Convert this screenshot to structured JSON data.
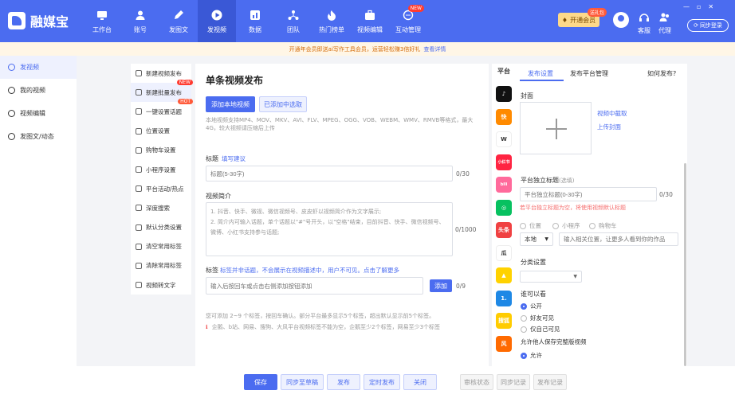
{
  "app": {
    "name": "融媒宝",
    "vip_label": "开通会员",
    "vip_tag": "送礼包"
  },
  "nav": [
    {
      "label": "工作台",
      "icon": "monitor-icon"
    },
    {
      "label": "账号",
      "icon": "user-icon"
    },
    {
      "label": "发图文",
      "icon": "pen-icon"
    },
    {
      "label": "发视频",
      "icon": "play-icon",
      "active": true
    },
    {
      "label": "数据",
      "icon": "chart-icon"
    },
    {
      "label": "团队",
      "icon": "team-icon"
    },
    {
      "label": "热门榜单",
      "icon": "fire-icon"
    },
    {
      "label": "视频编辑",
      "icon": "briefcase-icon"
    },
    {
      "label": "互动管理",
      "icon": "chat-icon",
      "badge": "NEW"
    }
  ],
  "tools": {
    "service": "客服",
    "agent": "代理",
    "sync": "同步登录"
  },
  "notice": {
    "text": "开通年会员即送ai写作工具会员，运营轻松赚3倍好礼",
    "link": "查看详情"
  },
  "sidebar": [
    {
      "label": "发视频",
      "active": true
    },
    {
      "label": "我的视频"
    },
    {
      "label": "视频编辑"
    },
    {
      "label": "发图文/动态"
    }
  ],
  "submenu": [
    {
      "label": "新建视频发布",
      "icon": "list-icon"
    },
    {
      "label": "新建批量发布",
      "icon": "batch-icon",
      "active": true,
      "badge": "NEW",
      "badge_color": "#ff3b30"
    },
    {
      "label": "一键设置话题",
      "icon": "hash-icon",
      "badge": "HOT",
      "badge_color": "#ff5a3a"
    },
    {
      "label": "位置设置",
      "icon": "location-icon"
    },
    {
      "label": "购物车设置",
      "icon": "cart-icon"
    },
    {
      "label": "小程序设置",
      "icon": "miniapp-icon"
    },
    {
      "label": "平台活动/热点",
      "icon": "flag-icon"
    },
    {
      "label": "深度搜索",
      "icon": "search-icon"
    },
    {
      "label": "默认分类设置",
      "icon": "category-icon"
    },
    {
      "label": "清空常用标签",
      "icon": "tag-icon"
    },
    {
      "label": "清除常用标签",
      "icon": "tag-icon"
    },
    {
      "label": "视频转文字",
      "icon": "transcribe-icon"
    }
  ],
  "form": {
    "title": "单条视频发布",
    "add_local": "添加本地视频",
    "add_existing": "已添加中选取",
    "format_hint": "本地视频支持MP4、MOV、MKV、AVI、FLV、MPEG、OGG、VOB、WEBM、WMV、RMVB等格式，最大4G，较大视频请压缩后上传",
    "title_label": "标题",
    "title_tip": "填写建议",
    "title_placeholder": "标题(5-30字)",
    "title_count": "0/30",
    "desc_label": "视频简介",
    "desc_line1": "1. 抖音、快手、微视、微信视频号、皮皮虾以视频简介作为文字展示;",
    "desc_line2": "2. 简介内可输入话题，单个话题以\"#\"号开头，以\"空格\"结束，目前抖音、快手、微信视频号、微博、小红书支持参与话题;",
    "desc_count": "0/1000",
    "tag_label": "标签",
    "tag_tip": "标签并非话题，不会展示在视频描述中，用户不可见。点击了解更多",
    "tag_placeholder": "输入后按回车或点击右侧添加按钮添加",
    "tag_add": "添加",
    "tag_count": "0/9",
    "tag_hint": "您可添加 2~9 个标签，按回车确认。部分平台最多显示5个标签，超出默认显示前5个标签。",
    "tag_warn": "企鹅、b站、网易、搜狗、大风平台视频标签不能为空，企鹅至少2个标签，网易至少3个标签"
  },
  "platforms": {
    "header": "平台",
    "items": [
      {
        "name": "抖音",
        "color": "#111111",
        "text": "♪"
      },
      {
        "name": "快手",
        "color": "#ff8a00",
        "text": "快"
      },
      {
        "name": "微视",
        "color": "#ffffff",
        "text": "W"
      },
      {
        "name": "小红书",
        "color": "#ff2442",
        "text": "小红书"
      },
      {
        "name": "哔哩",
        "color": "#ff6a9b",
        "text": "bili"
      },
      {
        "name": "微信视频号",
        "color": "#07c160",
        "text": "◎"
      },
      {
        "name": "头条",
        "color": "#f04142",
        "text": "头条"
      },
      {
        "name": "西瓜",
        "color": "#ffffff",
        "text": "瓜"
      },
      {
        "name": "企鹅",
        "color": "#ffd200",
        "text": "▲"
      },
      {
        "name": "一点",
        "color": "#1e88e5",
        "text": "1."
      },
      {
        "name": "搜狐",
        "color": "#ffcc00",
        "text": "搜狐"
      },
      {
        "name": "大风",
        "color": "#ff6a00",
        "text": "风"
      }
    ]
  },
  "right": {
    "tabs": [
      "发布设置",
      "发布平台管理"
    ],
    "help": "如何发布?",
    "cover_label": "封面",
    "cover_capture": "视频中截取",
    "cover_upload": "上传封面",
    "ptitle_label": "平台独立标题",
    "ptitle_optional": "(选填)",
    "ptitle_placeholder": "平台独立标题(0-30字)",
    "ptitle_count": "0/30",
    "ptitle_warn": "若平台独立标题为空，将使用视频默认标题",
    "opt_location": "位置",
    "opt_miniapp": "小程序",
    "opt_cart": "购物车",
    "loc_select": "本地",
    "loc_placeholder": "输入相关位置，让更多人看到你的作品",
    "category_label": "分类设置",
    "who_label": "谁可以看",
    "who_options": [
      "公开",
      "好友可见",
      "仅自己可见"
    ],
    "save_label": "允许他人保存完整版视频",
    "save_option": "允许"
  },
  "bottom": {
    "save": "保存",
    "draft": "同步至草稿",
    "publish": "发布",
    "scheduled": "定时发布",
    "close": "关闭",
    "audit": "审核状态",
    "sync_log": "同步记录",
    "publish_log": "发布记录"
  }
}
